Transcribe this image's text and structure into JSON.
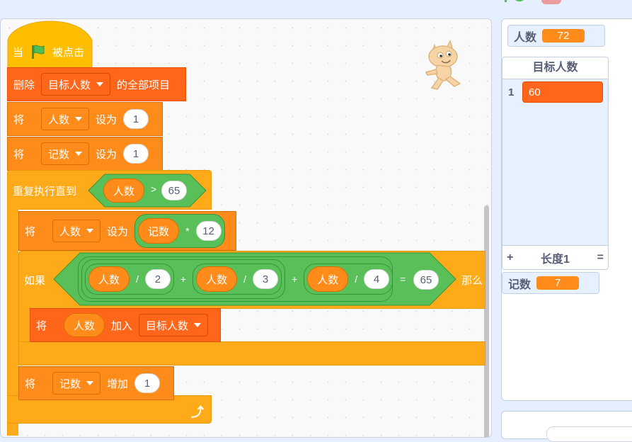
{
  "header": {
    "green_flag": "green-flag-icon",
    "stop": "stop-icon"
  },
  "colors": {
    "event": "#ffbf00",
    "control": "#ffab19",
    "variable": "#ff8c1a",
    "list": "#ff661a",
    "operator": "#59c059",
    "workspace_bg": "#f9f9f9",
    "stage_bg": "#e5efff"
  },
  "script": {
    "hat": {
      "label_when": "当",
      "flag_icon": "green-flag-icon",
      "label_clicked": "被点击"
    },
    "delete_all": {
      "label": "删除",
      "list": "目标人数",
      "suffix": "的全部项目"
    },
    "set1": {
      "label": "将",
      "var": "人数",
      "to": "设为",
      "value": "1"
    },
    "set2": {
      "label": "将",
      "var": "记数",
      "to": "设为",
      "value": "1"
    },
    "repeat_until": {
      "label": "重复执行直到",
      "left": "人数",
      "op": ">",
      "right": "65"
    },
    "set3": {
      "label": "将",
      "var": "人数",
      "to": "设为",
      "left": "记数",
      "op": "*",
      "right": "12"
    },
    "if_block": {
      "label": "如果",
      "t1_var": "人数",
      "t1_op": "/",
      "t1_num": "2",
      "plus1": "+",
      "t2_var": "人数",
      "t2_op": "/",
      "t2_num": "3",
      "plus2": "+",
      "t3_var": "人数",
      "t3_op": "/",
      "t3_num": "4",
      "eq": "=",
      "eq_value": "65",
      "then": "那么"
    },
    "add_to": {
      "label": "将",
      "var": "人数",
      "verb": "加入",
      "list": "目标人数"
    },
    "change": {
      "label": "将",
      "var": "记数",
      "verb": "增加",
      "value": "1"
    },
    "loop_icon": "loop-arrow-icon"
  },
  "stage": {
    "sprite": "cat-sprite",
    "monitor_people": {
      "label": "人数",
      "value": "72"
    },
    "list_monitor": {
      "title": "目标人数",
      "items": [
        {
          "index": "1",
          "value": "60"
        }
      ],
      "add": "+",
      "length_label": "长度1",
      "resize": "="
    },
    "monitor_count": {
      "label": "记数",
      "value": "7"
    }
  }
}
